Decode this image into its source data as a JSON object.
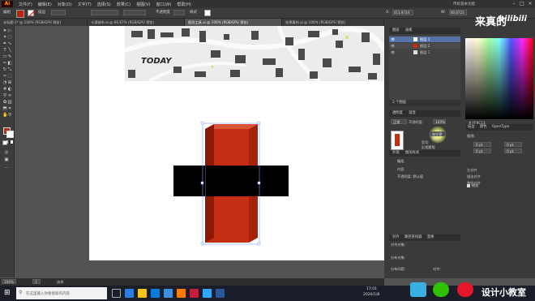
{
  "app": {
    "logo": "Ai"
  },
  "menu": {
    "items": [
      "文件(F)",
      "编辑(E)",
      "对象(O)",
      "文字(T)",
      "选择(S)",
      "效果(C)",
      "视图(V)",
      "窗口(W)",
      "帮助(H)"
    ],
    "workspace": "传统基本功能"
  },
  "control": {
    "selection": "编组",
    "stroke_label": "描边",
    "opacity_label": "不透明度",
    "style_label": "样式",
    "x": "X:",
    "x_value": "411.9734",
    "w": "W:",
    "w_value": "60.6723"
  },
  "tabs": [
    {
      "label": "未标题-1* @ 100% (RGB/GPU 预览)"
    },
    {
      "label": "卡通城市.ai @ 66.67% (RGB/GPU 预览)"
    },
    {
      "label": "图形工具.ai @ 100% (RGB/GPU 预览)"
    },
    {
      "label": "效果素材.ai @ 100% (RGB/GPU 预览)"
    }
  ],
  "canvas": {
    "map_text": "TODAY",
    "colors": {
      "red_front": "#c42e12",
      "red_side": "#8b1a05",
      "red_top": "#d85436",
      "black": "#000000"
    }
  },
  "layers": {
    "tabs": [
      "图层",
      "画板"
    ],
    "items": [
      {
        "name": "图层 1"
      },
      {
        "name": "图层 2"
      },
      {
        "name": "图层 1"
      }
    ],
    "footer": "2 个图层"
  },
  "transparency": {
    "tabs": [
      "透明度",
      "渐变"
    ],
    "mode": "正常",
    "opacity_label": "不透明度:",
    "opacity": "100%",
    "mask_button": "制作蒙版",
    "clip": "剪切",
    "invert": "反相蒙版"
  },
  "appearance": {
    "tabs": [
      "外观",
      "图形样式"
    ],
    "object": "编组",
    "content": "内容",
    "opacity": "不透明度: 默认值"
  },
  "align": {
    "tabs": [
      "对齐",
      "路径查找器",
      "变换"
    ],
    "align_objects": "对齐对象:",
    "distribute_objects": "分布对象:",
    "distribute_spacing": "分布间距:",
    "align_to": "对齐:"
  },
  "color": {
    "hex": "# FF9C13"
  },
  "stroke": {
    "tabs": [
      "描边",
      "颜色",
      "OpenType"
    ],
    "weight_label": "粗细:",
    "values": [
      "0 pt",
      "0 pt",
      "0 pt",
      "0 pt"
    ],
    "label_a": "左对齐",
    "label_b": "描边对齐",
    "label_c": "路径对齐",
    "checkbox": "缩放"
  },
  "status": {
    "zoom": "100%",
    "page": "1",
    "tool": "选择"
  },
  "taskbar": {
    "search_placeholder": "在这里输入你要搜索的内容",
    "time": "17:01",
    "date": "2020/1/8"
  },
  "watermark": {
    "top_text": "来真的",
    "top_logo": "bilibili",
    "bottom_text": "设计小教室"
  }
}
